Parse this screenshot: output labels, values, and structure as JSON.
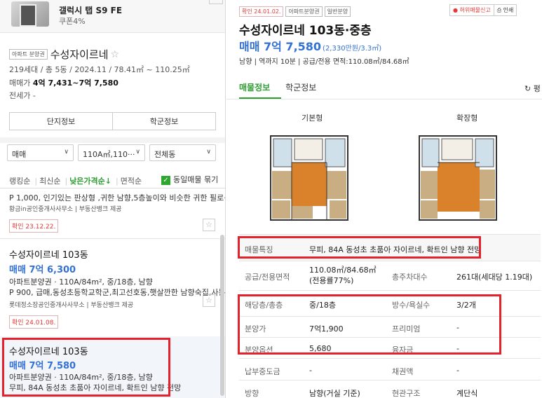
{
  "ad": {
    "title": "갤럭시 탭 S9 FE",
    "coupon": "쿠폰4%"
  },
  "complex": {
    "type_tag": "아파트 분양권",
    "name": "수성자이르네",
    "info": "219세대 / 총 5동 / 2024.11 / 78.41㎡ ~ 110.25㎡",
    "price_label": "매매가",
    "price_range": "4억 7,431~7억 7,580",
    "jeonse": "전세가 -",
    "btn_danji": "단지정보",
    "btn_school": "학군정보"
  },
  "filters": {
    "trade": "매매",
    "area": "110A㎡,110···",
    "dong": "전체동"
  },
  "sorts": {
    "ranking": "랭킹순",
    "latest": "최신순",
    "low_price": "낮은가격순↓",
    "area": "면적순",
    "same_group": "동일매물 묶기"
  },
  "list": [
    {
      "desc": "P 1,000, 인기있는 판상형 ,귀한 남향,5층높이와 비슷한 귀한 필로···",
      "agent": "황금in공인중개사사무소 | 부동산뱅크 제공",
      "confirm": "확인 23.12.22."
    },
    {
      "name": "수성자이르네 103동",
      "price": "매매 7억 6,300",
      "spec": "아파트분양권 · 110A/84m², 중/18층, 남향",
      "desc": "P 900, 급매,동성초등학교학군,최고선호동,햇살깐한 남향숙집,사통···",
      "agent": "롯데정소장공인중개사사무소 | 부동산뱅크 제공",
      "confirm": "확인 24.01.08."
    },
    {
      "name": "수성자이르네 103동",
      "price": "매매 7억 7,580",
      "spec": "아파트분양권 · 110A/84m², 중/18층, 남향",
      "desc": "무피, 84A 동성초 초품아 자이르네, 확트인 남향 전망"
    }
  ],
  "detail": {
    "tag_confirm": "확인 24.01.02.",
    "tag_type": "아파트분양권",
    "tag_general": "일반분양",
    "report": "허위매물신고",
    "print": "인쇄",
    "title": "수성자이르네 103동·중층",
    "price": "매매 7억 7,580",
    "price_sub": "(2,330만원/3.3㎡)",
    "meta": "남향 | 역까지 10분 | 공급/전용 면적:110.08㎡/84.68㎡",
    "tab_info": "매물정보",
    "tab_school": "학군정보",
    "refresh": "평",
    "fp_basic": "기본형",
    "fp_ext": "확장형"
  },
  "table": [
    {
      "k1": "매물특징",
      "v1": "무피, 84A 동성초 초품아 자이르네, 확트인 남향 전망"
    },
    {
      "k1": "공급/전용면적",
      "v1": "110.08㎡/84.68㎡(전용률77%)",
      "k2": "총주차대수",
      "v2": "261대(세대당 1.19대)"
    },
    {
      "k1": "해당층/총층",
      "v1": "중/18층",
      "k2": "방수/욕실수",
      "v2": "3/2개"
    },
    {
      "k1": "분양가",
      "v1": "7억1,900",
      "k2": "프리미엄",
      "v2": "-"
    },
    {
      "k1": "분양옵션",
      "v1": "5,680",
      "k2": "융자금",
      "v2": "-"
    },
    {
      "k1": "납부중도금",
      "v1": "-",
      "k2": "채권액",
      "v2": "-"
    },
    {
      "k1": "방향",
      "v1": "남향(거실 기준)",
      "k2": "현관구조",
      "v2": "계단식"
    }
  ],
  "colors": {
    "accent_green": "#2e9e33",
    "price_blue": "#3371d4",
    "highlight_red": "#e5222b"
  }
}
